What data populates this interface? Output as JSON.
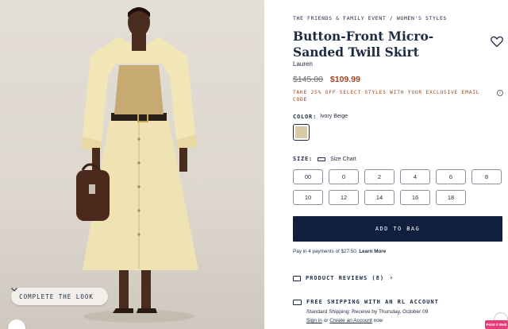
{
  "product_image": {
    "complete_look_label": "COMPLETE THE LOOK",
    "icons": [
      "chevron-down-icon",
      "zoom-icon"
    ]
  },
  "breadcrumb": "THE FRIENDS & FAMILY EVENT / WOMEN'S STYLES",
  "product": {
    "title": "Button-Front Micro-Sanded Twill Skirt",
    "brand": "Lauren",
    "price_original": "$145.00",
    "price_sale": "$109.99",
    "promo": "TAKE 25% OFF SELECT STYLES WITH YOUR EXCLUSIVE EMAIL CODE",
    "promo_info": "i"
  },
  "color": {
    "label": "COLOR:",
    "selected": "Ivory Beige",
    "swatch_hex": "#d8c9a7"
  },
  "size": {
    "label": "SIZE:",
    "chart_link": "Size Chart",
    "options": [
      "00",
      "0",
      "2",
      "4",
      "6",
      "8",
      "10",
      "12",
      "14",
      "16",
      "18"
    ]
  },
  "add_to_bag": "ADD TO BAG",
  "installments": {
    "text": "Pay in 4 payments of $27.50.",
    "link": "Learn More"
  },
  "reviews": {
    "label": "PRODUCT REVIEWS (8)",
    "chevron": "›"
  },
  "shipping": {
    "title": "FREE SHIPPING WITH AN RL ACCOUNT",
    "subtitle": "Standard Shipping: Receive by Thursday, October 09",
    "sign_in": "Sign in",
    "or": "or",
    "create_account": "Create an Account",
    "suffix": "now"
  },
  "badge": "Point It Web",
  "colors": {
    "navy": "#0f1f3d",
    "sale": "#a0421f",
    "badge": "#e63d7a"
  }
}
